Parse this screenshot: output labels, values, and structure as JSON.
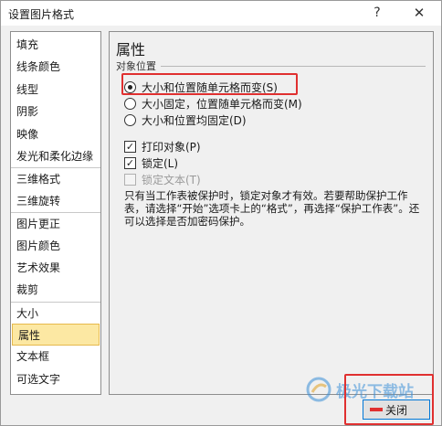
{
  "window": {
    "title": "设置图片格式",
    "help_label": "?",
    "close_label": "✕"
  },
  "sidebar": {
    "items": [
      {
        "label": "填充"
      },
      {
        "label": "线条颜色"
      },
      {
        "label": "线型"
      },
      {
        "label": "阴影"
      },
      {
        "label": "映像"
      },
      {
        "label": "发光和柔化边缘"
      },
      {
        "label": "三维格式"
      },
      {
        "label": "三维旋转"
      },
      {
        "label": "图片更正"
      },
      {
        "label": "图片颜色"
      },
      {
        "label": "艺术效果"
      },
      {
        "label": "裁剪"
      },
      {
        "label": "大小"
      },
      {
        "label": "属性"
      },
      {
        "label": "文本框"
      },
      {
        "label": "可选文字"
      }
    ],
    "selected": "属性"
  },
  "main": {
    "section_title": "属性",
    "object_position_label": "对象位置",
    "radio_options": [
      {
        "label": "大小和位置随单元格而变(S)",
        "checked": true
      },
      {
        "label": "大小固定，位置随单元格而变(M)",
        "checked": false
      },
      {
        "label": "大小和位置均固定(D)",
        "checked": false
      }
    ],
    "checkbox_options": [
      {
        "label": "打印对象(P)",
        "checked": true,
        "enabled": true
      },
      {
        "label": "锁定(L)",
        "checked": true,
        "enabled": true
      },
      {
        "label": "锁定文本(T)",
        "checked": false,
        "enabled": false
      }
    ],
    "description": "只有当工作表被保护时，锁定对象才有效。若要帮助保护工作表，请选择“开始”选项卡上的“格式”，再选择“保护工作表”。还可以选择是否加密码保护。"
  },
  "footer": {
    "close_button_label": "关闭"
  },
  "watermark": {
    "text": "极光下载站"
  },
  "colors": {
    "highlight_red": "#e03030",
    "selected_item_bg": "#fce8a3",
    "button_focus_border": "#0078d7"
  }
}
